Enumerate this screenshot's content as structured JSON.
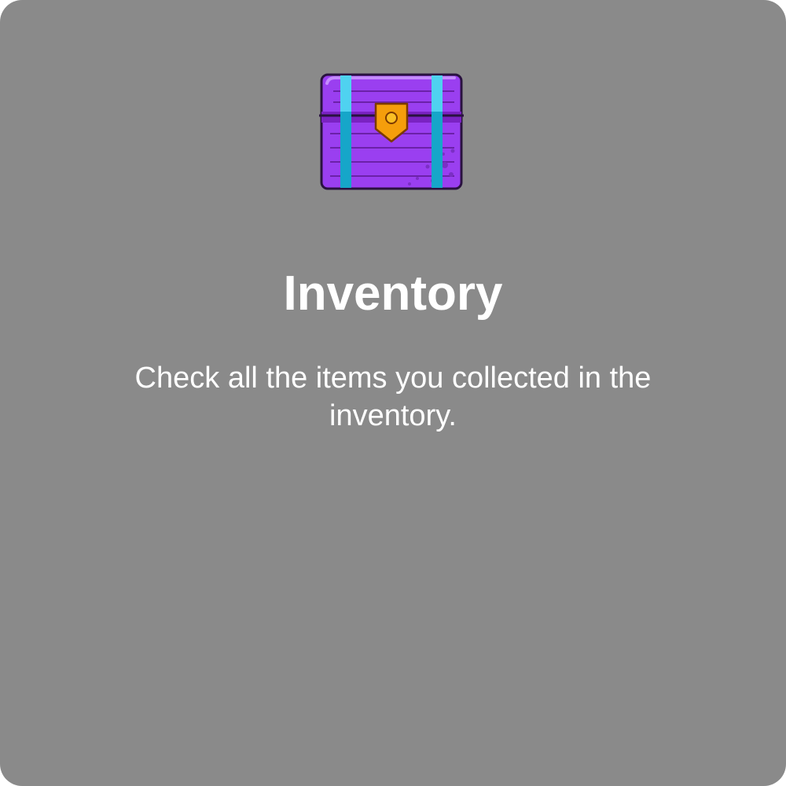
{
  "popup": {
    "icon": "treasure-chest-icon",
    "title": "Inventory",
    "description": "Check all the items you collected in the inventory."
  },
  "colors": {
    "background": "#8a8a8a",
    "text": "#ffffff",
    "chest_body": "#9333ea",
    "chest_band": "#22b8d8",
    "chest_lock": "#f59e0b"
  }
}
